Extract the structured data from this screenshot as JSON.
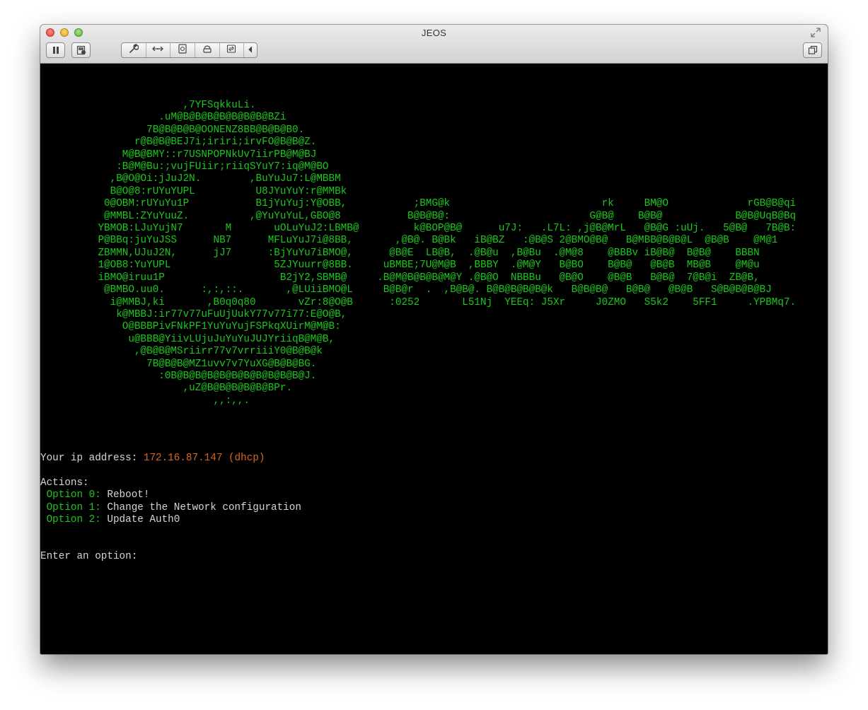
{
  "window": {
    "title": "JEOS"
  },
  "toolbar": {
    "buttons": [
      {
        "icon": "pause-icon"
      },
      {
        "icon": "snapshot-icon"
      },
      {
        "icon": "wrench-icon"
      },
      {
        "icon": "network-arrows-icon"
      },
      {
        "icon": "disk-icon"
      },
      {
        "icon": "printer-icon"
      },
      {
        "icon": "sync-icon"
      },
      {
        "icon": "chevron-left-icon"
      },
      {
        "icon": "unity-icon"
      }
    ]
  },
  "console": {
    "ascii_art": [
      "                    ,7YFSqkkuLi.",
      "                .uM@B@B@B@B@B@B@B@BZi",
      "              7B@B@B@B@OONENZ8BB@B@B@B0.",
      "            r@B@B@BEJ7i;iriri;irvFO@B@B@Z.",
      "          M@B@BMY::r7USNPOPNkUv7iirPB@M@BJ",
      "         :B@M@Bu:;vujFUiir;riiqSYuY7:iq@M@BO",
      "        ,B@O@Oi:jJuJ2N.        ,BuYuJu7:L@MBBM",
      "        B@O@8:rUYuYUPL          U8JYuYuY:r@MMBk",
      "       0@OBM:rUYuYu1P           B1jYuYuj:Y@OBB,           ;BMG@k                         rk     BM@O             rGB@B@qi",
      "       @MMBL:ZYuYuuZ.          ,@YuYuYuL,GBO@8           B@B@B@:                       G@B@    B@B@            B@B@UqB@Bq",
      "      YBMOB:LJuYujN7       M       uOLuYuJ2:LBMB@         k@BOP@B@      u7J:   .L7L: ,j@B@MrL   @B@G :uUj.   5@B@   7B@B:",
      "      P@BBq:juYuJSS      NB7      MFLuYuJ7i@8BB,       ,@B@. B@Bk   iB@BZ   :@B@S 2@BMO@B@   B@MBB@B@B@L  @B@B    @M@1",
      "      ZBMMN,UJuJ2N,      jJ7      :BjYuYu7iBMO@,      @B@E  LB@B,  .@B@u  ,B@Bu  .@M@8    @BBBv iB@B@  B@B@    BBBN",
      "      1@OB8:YuYUPL                 5ZJYuurr@8BB.     uBMBE;7U@M@B  ,BBBY  .@M@Y   B@BO    B@B@   @B@B  MB@B    @M@u",
      "      iBMO@iruu1P                   B2jY2,SBMB@     .B@M@B@B@B@M@Y .@B@O  NBBBu   @B@O    @B@B   B@B@  7@B@i  ZB@B,",
      "       @BMBO.uu0.      :,:,::.       ,@LUiiBMO@L     B@B@r  .  ,B@B@. B@B@B@B@B@k   B@B@B@   B@B@   @B@B   S@B@B@B@BJ",
      "        i@MMBJ,ki       ,B0q0q80       vZr:8@O@B      :0252       L51Nj  YEEq: J5Xr     J0ZMO   S5k2    5FF1     .YPBMq7.",
      "         k@MBBJ:ir77v77uFuUjUukY77v77i77:E@O@B,",
      "          O@BBBPivFNkPF1YuYuYujFSPkqXUirM@M@B:",
      "           u@BBB@YiivLUjuJuYuYuJUJYriiqB@M@B,",
      "            ,@B@B@MSriirr77v7vrriiiY0@B@B@k",
      "              7B@B@B@MZ1uvv7v7YuXG@B@B@BG.",
      "                :0B@B@B@B@B@B@B@B@B@B@B@J.",
      "                    ,uZ@B@B@B@B@B@BPr.",
      "                         ,,:,,."
    ],
    "ip_label": "Your ip address: ",
    "ip_value": "172.16.87.147 (dhcp)",
    "actions_label": "Actions:",
    "options": [
      {
        "key": " Option 0: ",
        "label": "Reboot!"
      },
      {
        "key": " Option 1: ",
        "label": "Change the Network configuration"
      },
      {
        "key": " Option 2: ",
        "label": "Update Auth0"
      }
    ],
    "prompt": "Enter an option:"
  },
  "colors": {
    "terminal_bg": "#000000",
    "ascii_green": "#1cc81c",
    "ip_orange": "#d9661e",
    "text_gray": "#d6d6d6"
  }
}
